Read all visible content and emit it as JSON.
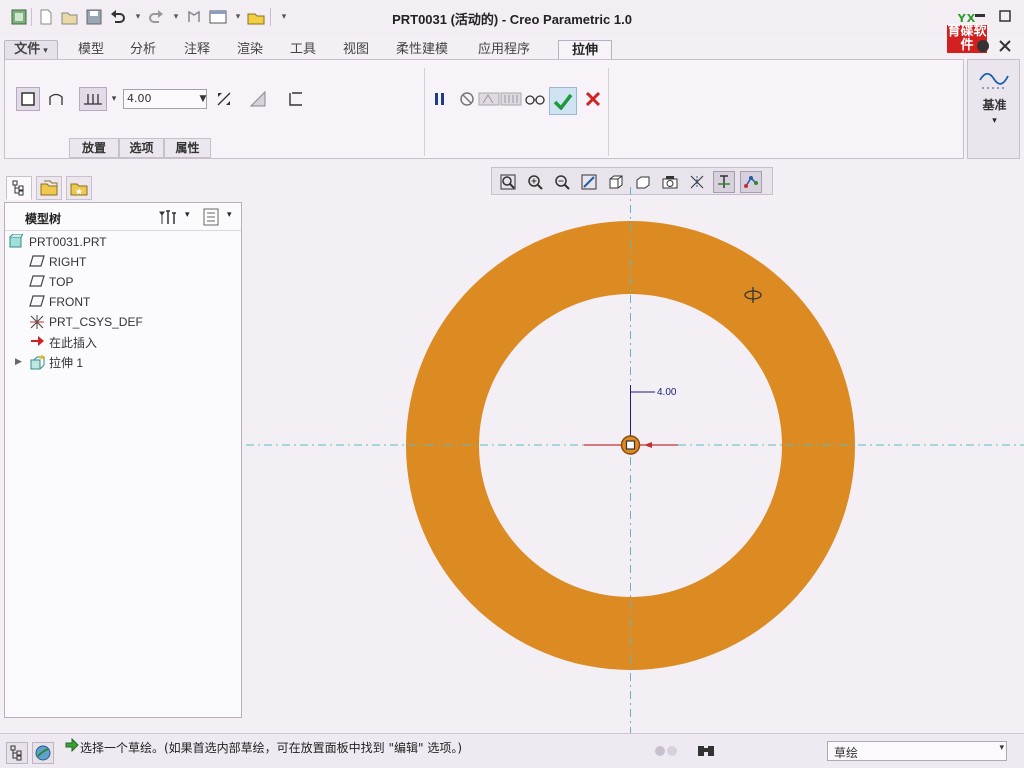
{
  "window": {
    "title": "PRT0031 (活动的) - Creo Parametric 1.0",
    "logo_top": "YX",
    "logo_text": "育碟软件"
  },
  "ribbon": {
    "tabs": [
      {
        "label": "文件",
        "dropdown": "▾"
      },
      {
        "label": "模型"
      },
      {
        "label": "分析"
      },
      {
        "label": "注释"
      },
      {
        "label": "渲染"
      },
      {
        "label": "工具"
      },
      {
        "label": "视图"
      },
      {
        "label": "柔性建模"
      },
      {
        "label": "应用程序"
      },
      {
        "label": "拉伸"
      }
    ],
    "active_tab": "拉伸",
    "depth_value": "4.00",
    "subtabs": [
      "放置",
      "选项",
      "属性"
    ],
    "datum_label": "基准",
    "datum_dropdown": "▾"
  },
  "model_tree": {
    "header": "模型树",
    "items": [
      {
        "label": "PRT0031.PRT",
        "icon": "part-icon"
      },
      {
        "label": "RIGHT",
        "icon": "datum-plane-icon"
      },
      {
        "label": "TOP",
        "icon": "datum-plane-icon"
      },
      {
        "label": "FRONT",
        "icon": "datum-plane-icon"
      },
      {
        "label": "PRT_CSYS_DEF",
        "icon": "csys-icon"
      },
      {
        "label": "在此插入",
        "icon": "insert-here-icon"
      },
      {
        "label": "拉伸 1",
        "icon": "extrude-icon"
      }
    ]
  },
  "graphics": {
    "dimension_label": "4.00",
    "part_color": "#dc8a22"
  },
  "status_bar": {
    "message": "选择一个草绘。(如果首选内部草绘，可在放置面板中找到 \"编辑\" 选项。)",
    "filter_value": "草绘",
    "filter_dropdown": "▾"
  },
  "colors": {
    "background": "#f4eff5",
    "accent_ok": "#1e9a3c",
    "accent_cancel": "#d42020",
    "axis": "#5fb8c4"
  }
}
